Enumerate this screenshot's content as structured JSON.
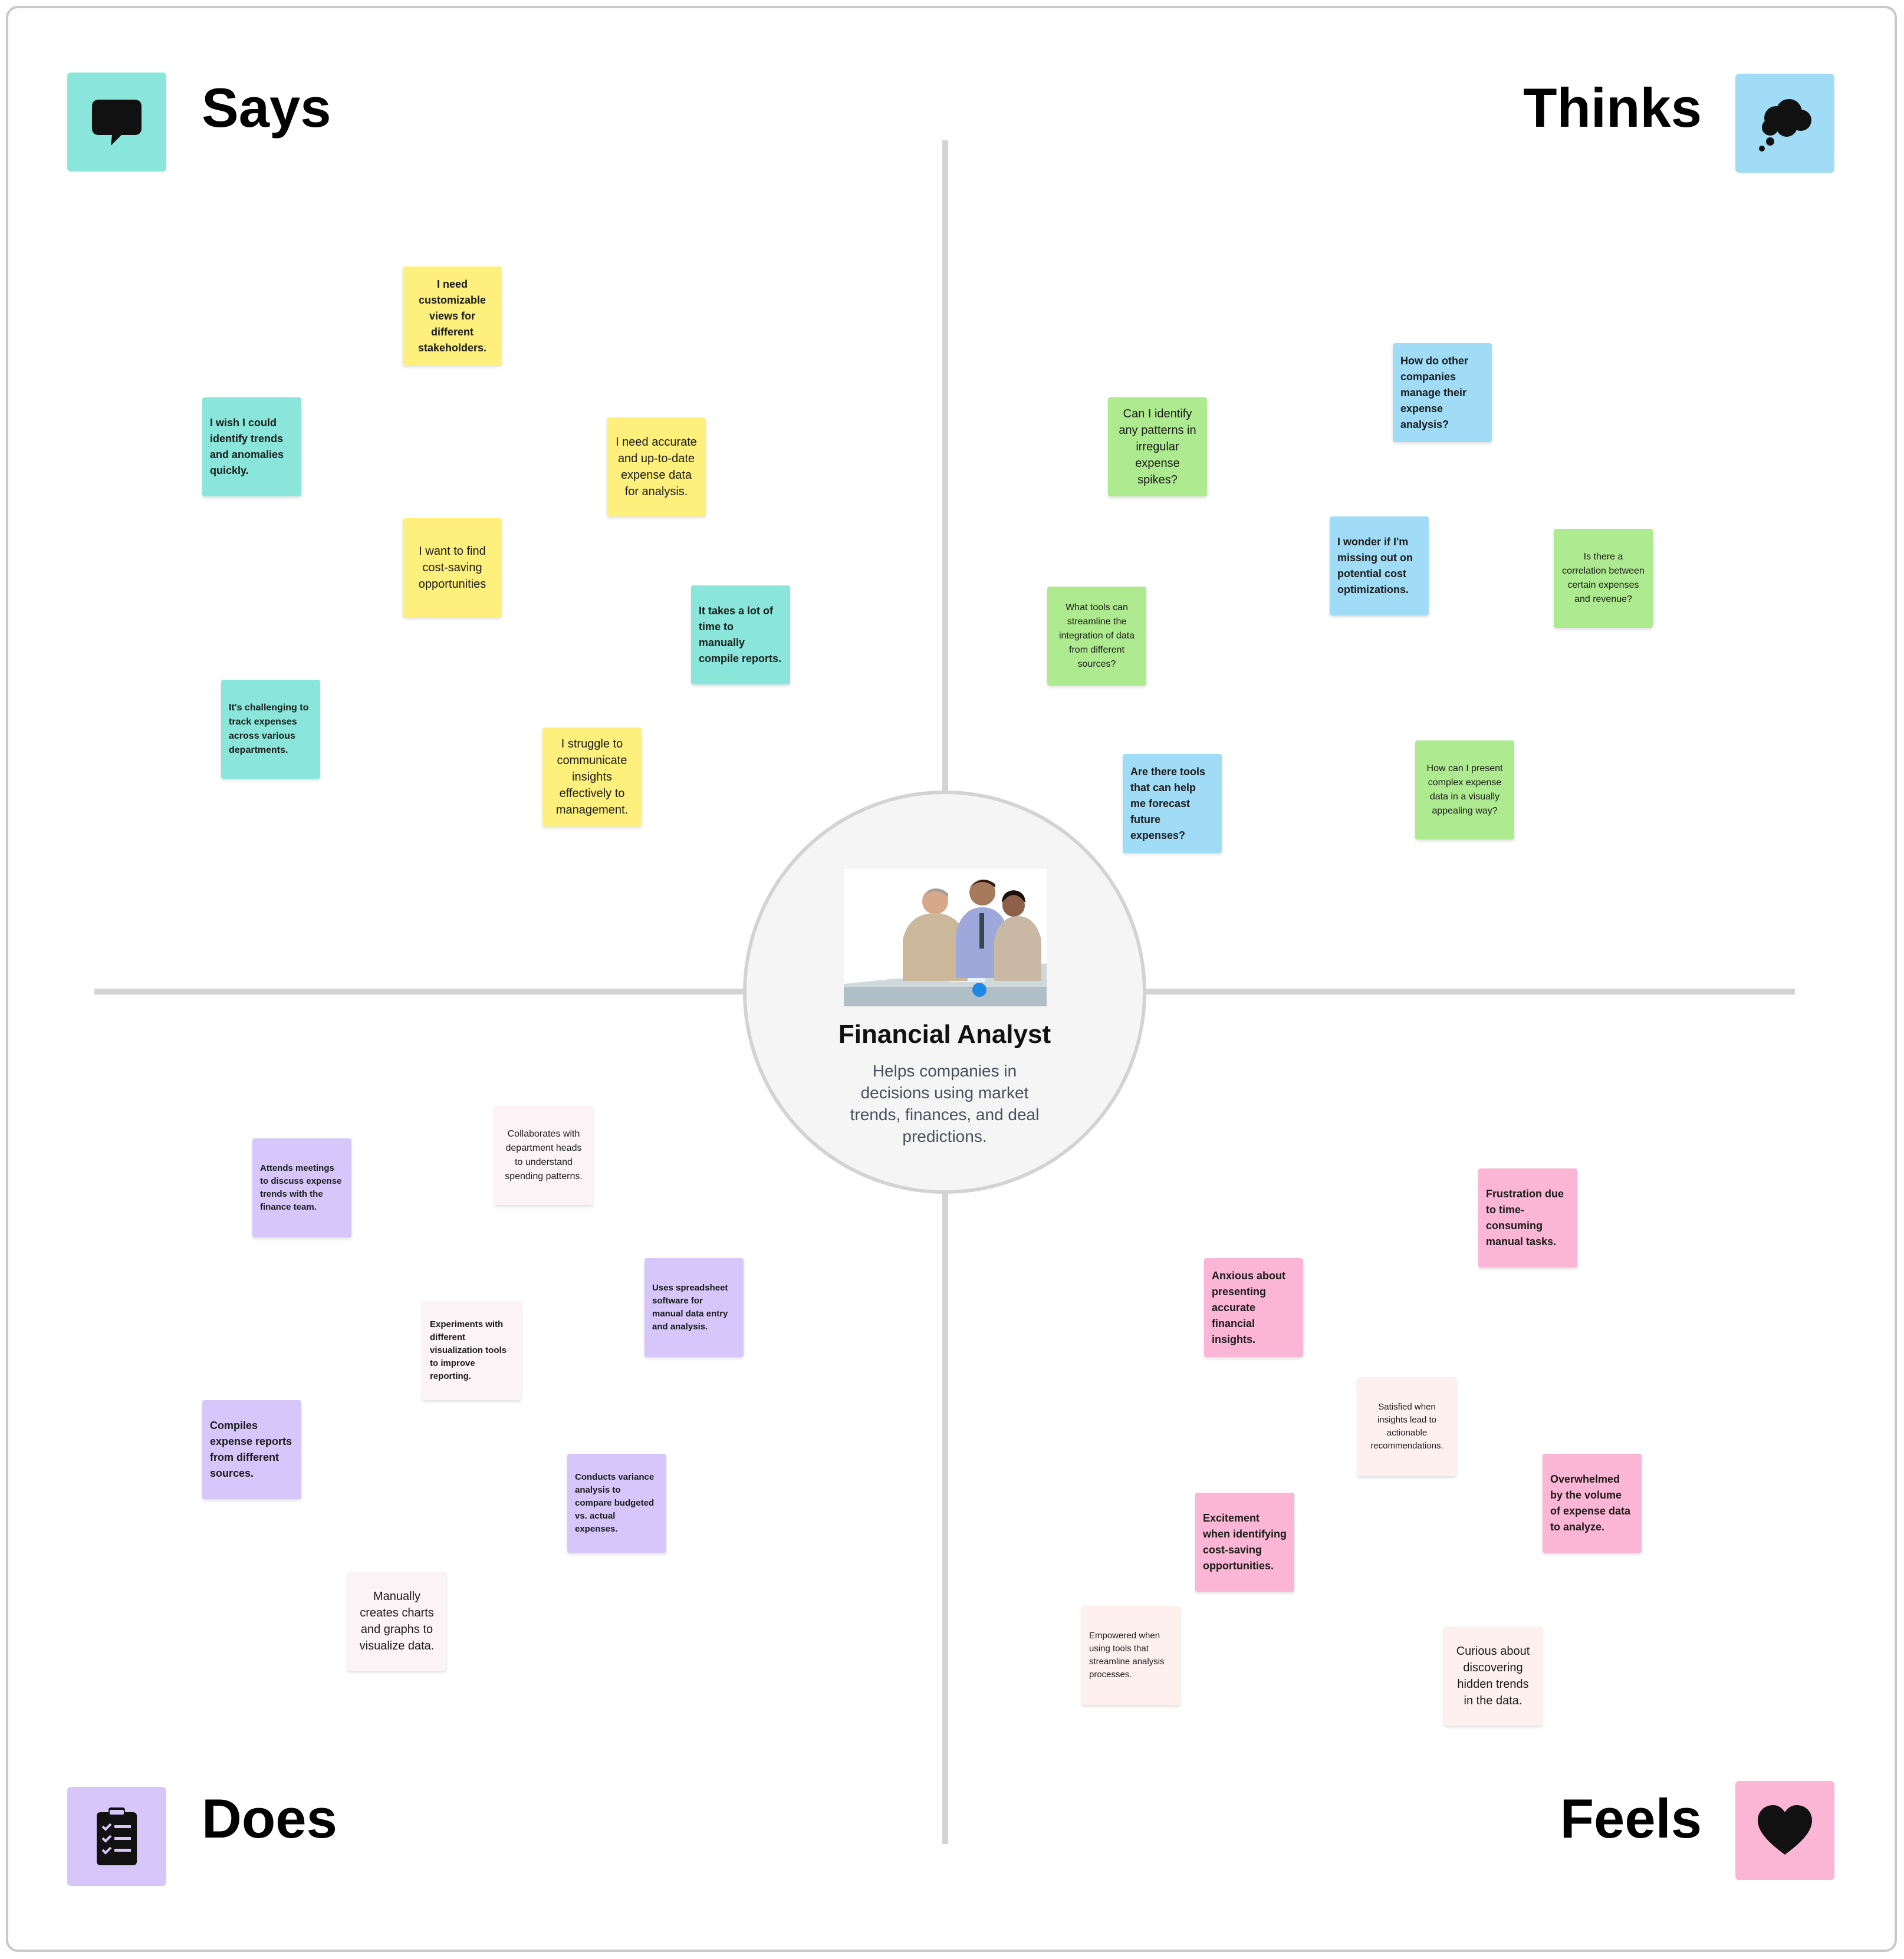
{
  "colors": {
    "says_teal": "#8ae6da",
    "says_yellow": "#fdf07c",
    "thinks_blue": "#a1dcf7",
    "thinks_green": "#aeea8f",
    "does_purple": "#d7c6fa",
    "does_light": "#fcf3f7",
    "feels_pink": "#fbb5d5",
    "feels_light": "#fdf0ef"
  },
  "quadrants": {
    "says": {
      "title": "Says",
      "icon": "speech-bubble-icon"
    },
    "thinks": {
      "title": "Thinks",
      "icon": "thought-cloud-icon"
    },
    "does": {
      "title": "Does",
      "icon": "clipboard-checklist-icon"
    },
    "feels": {
      "title": "Feels",
      "icon": "heart-icon"
    }
  },
  "persona": {
    "name": "Financial Analyst",
    "description": "Helps companies in decisions using market trends, finances, and deal predictions.",
    "photo": "business-team-photo"
  },
  "notes": {
    "says": [
      "I need customizable views for different stakeholders.",
      "I wish I could identify trends and anomalies quickly.",
      "I need accurate and up-to-date expense data for analysis.",
      "I want to find cost-saving opportunities",
      "It takes a lot of time to manually compile reports.",
      "It's challenging to track expenses across various departments.",
      "I struggle to communicate insights effectively to management."
    ],
    "thinks": [
      "How do other companies manage their expense analysis?",
      "Can I identify any patterns in irregular expense spikes?",
      "I wonder if I'm missing out on potential cost optimizations.",
      "Is there a correlation between certain expenses and revenue?",
      "What tools can streamline the integration of data from different sources?",
      "Are there tools that can help me forecast future expenses?",
      "How can I present complex expense data in a visually appealing way?"
    ],
    "does": [
      "Collaborates with department heads to understand spending patterns.",
      "Attends meetings to discuss expense trends with the finance team.",
      "Uses spreadsheet software for manual data entry and analysis.",
      "Experiments with different visualization tools to improve reporting.",
      "Compiles expense reports from different sources.",
      "Conducts variance analysis to compare budgeted vs. actual expenses.",
      "Manually creates charts and graphs to visualize data."
    ],
    "feels": [
      "Frustration due to time-consuming manual tasks.",
      "Anxious about presenting accurate financial insights.",
      "Satisfied when insights lead to actionable recommendations.",
      "Overwhelmed by the volume of expense data to analyze.",
      "Excitement when identifying cost-saving opportunities.",
      "Empowered when using tools that streamline analysis processes.",
      "Curious about discovering hidden trends in the data."
    ]
  }
}
